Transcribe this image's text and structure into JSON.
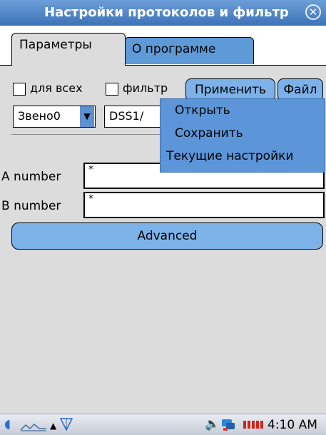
{
  "window": {
    "title": "Настройки протоколов и фильтр",
    "close_icon": "close-icon"
  },
  "tabs": [
    {
      "label": "Параметры",
      "active": true
    },
    {
      "label": "О программе",
      "active": false
    }
  ],
  "options": {
    "for_all_label": "для всех",
    "for_all_checked": false,
    "filter_label": "фильтр",
    "filter_checked": false,
    "apply_button": "Применить",
    "file_button": "Файл"
  },
  "selects": {
    "link_value": "Звено0",
    "protocol_value": "DSS1/"
  },
  "file_menu": {
    "items": [
      "Открыть",
      "Сохранить",
      "Текущие настройки"
    ]
  },
  "fields": {
    "a_number_label": "A number",
    "a_number_value": "*",
    "b_number_label": "B number",
    "b_number_value": "*"
  },
  "advanced_button": "Advanced",
  "taskbar": {
    "time": "4:10 AM",
    "icons": [
      "start-icon",
      "keyboard-icon",
      "up-arrow-icon",
      "signal-antenna-icon",
      "speaker-icon",
      "network-icon",
      "battery-icon"
    ]
  },
  "colors": {
    "accent": "#5c95d8",
    "title_bar": "#3d72b8",
    "background": "#dcdcdc"
  }
}
